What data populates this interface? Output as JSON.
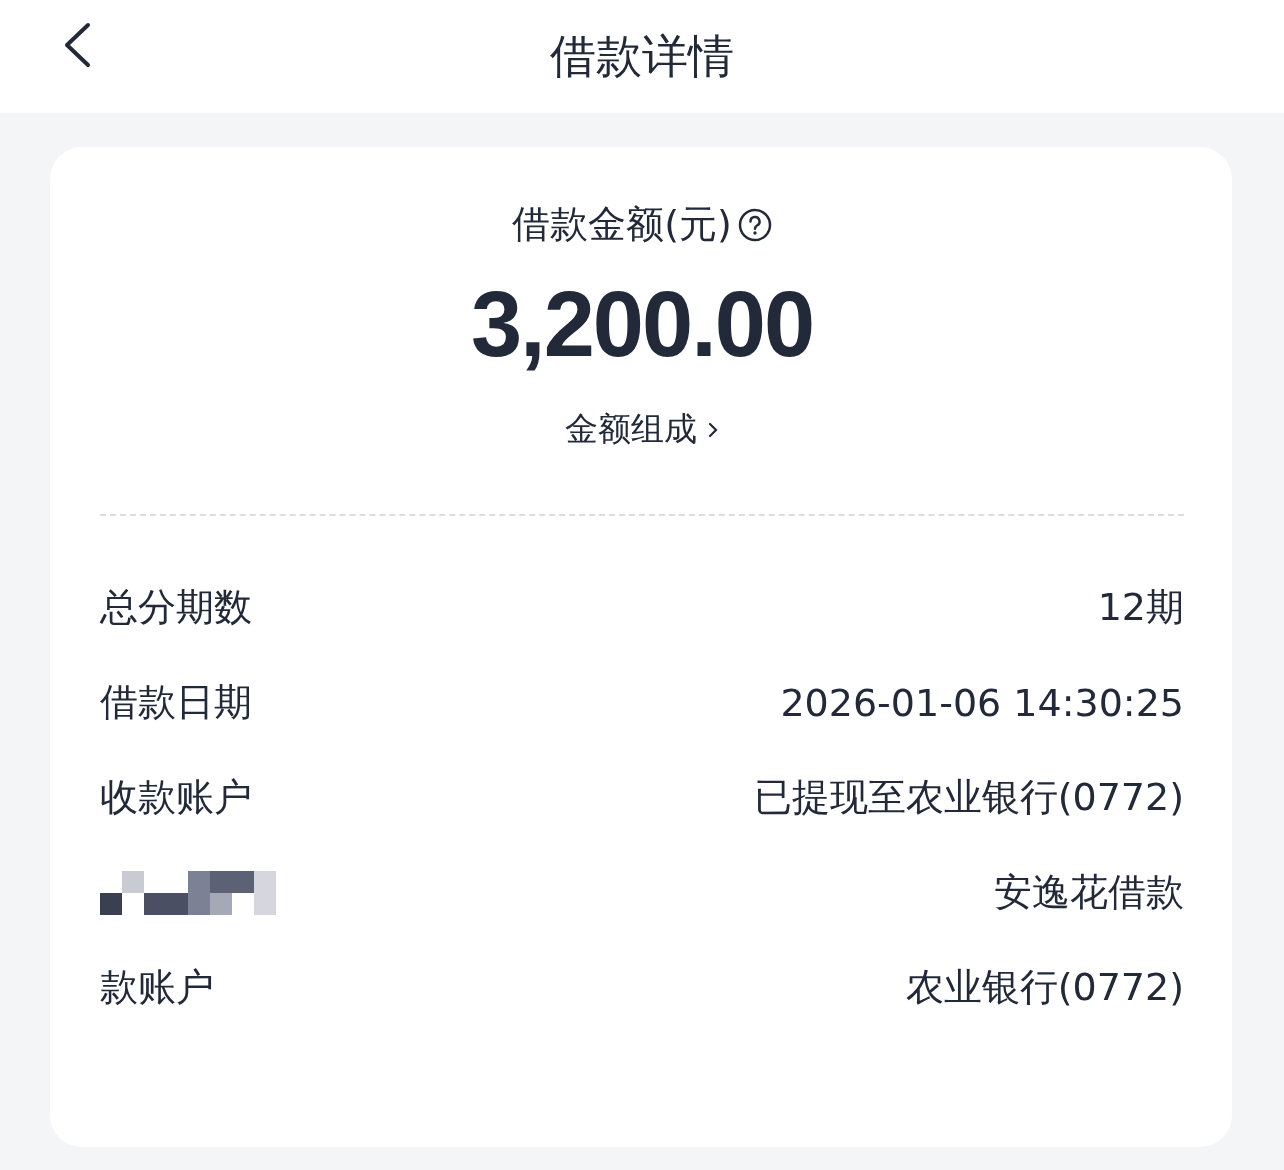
{
  "header": {
    "title": "借款详情"
  },
  "summary": {
    "label": "借款金额(元)",
    "amount": "3,200.00",
    "link": "金额组成"
  },
  "rows": [
    {
      "label": "总分期数",
      "value": "12期"
    },
    {
      "label": "借款日期",
      "value": "2026-01-06 14:30:25"
    },
    {
      "label": "收款账户",
      "value": "已提现至农业银行(0772)"
    },
    {
      "value": "安逸花借款"
    },
    {
      "label": "款账户",
      "value": "农业银行(0772)"
    }
  ]
}
